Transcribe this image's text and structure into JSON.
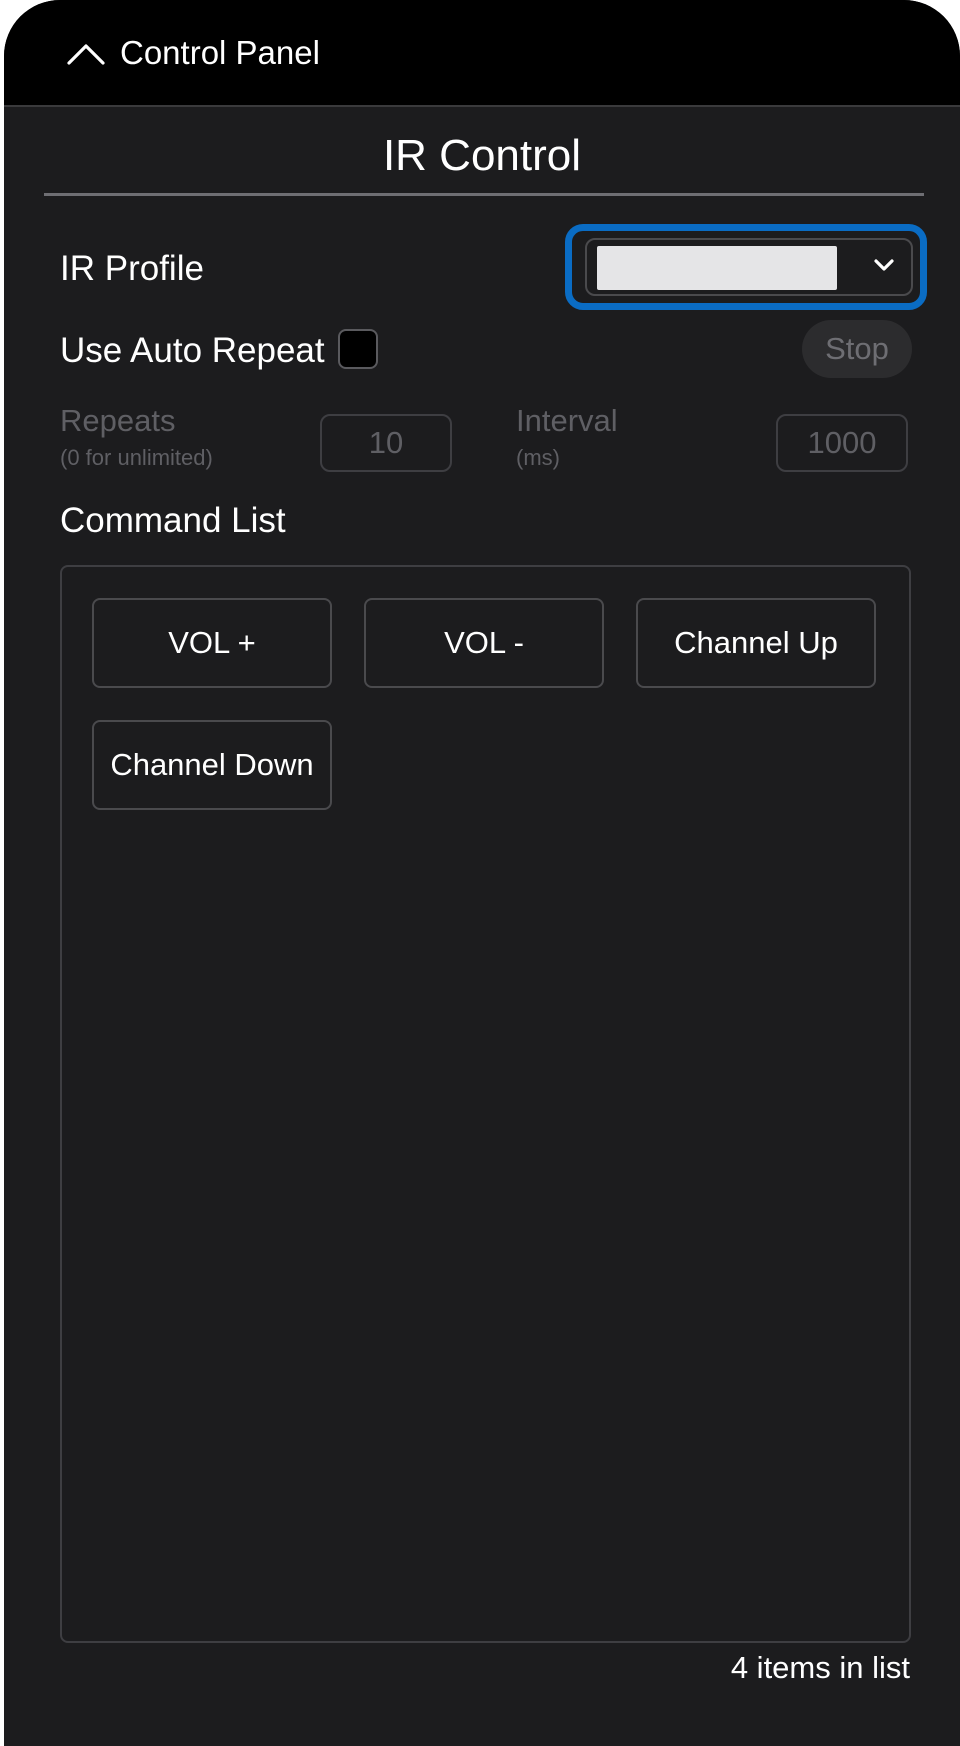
{
  "header": {
    "title": "Control Panel",
    "collapse_icon": "chevron-up-icon"
  },
  "ir_control": {
    "title": "IR Control",
    "profile": {
      "label": "IR Profile",
      "selected_value": "",
      "caret_icon": "chevron-down-icon",
      "focused": true,
      "focus_color": "#0a6cc4"
    },
    "auto_repeat": {
      "label": "Use Auto Repeat",
      "checked": false,
      "stop_label": "Stop",
      "stop_enabled": false
    },
    "repeats": {
      "label": "Repeats",
      "sublabel": "(0 for unlimited)",
      "value": "10",
      "enabled": false
    },
    "interval": {
      "label": "Interval",
      "sublabel": "(ms)",
      "value": "1000",
      "enabled": false
    }
  },
  "command_list": {
    "label": "Command List",
    "commands": [
      "VOL +",
      "VOL -",
      "Channel Up",
      "Channel Down"
    ],
    "count_text": "4 items in list"
  },
  "colors": {
    "background": "#1c1c1e",
    "header": "#000000",
    "text": "#ffffff",
    "disabled_text": "#5f5f64",
    "accent": "#0a6cc4"
  }
}
